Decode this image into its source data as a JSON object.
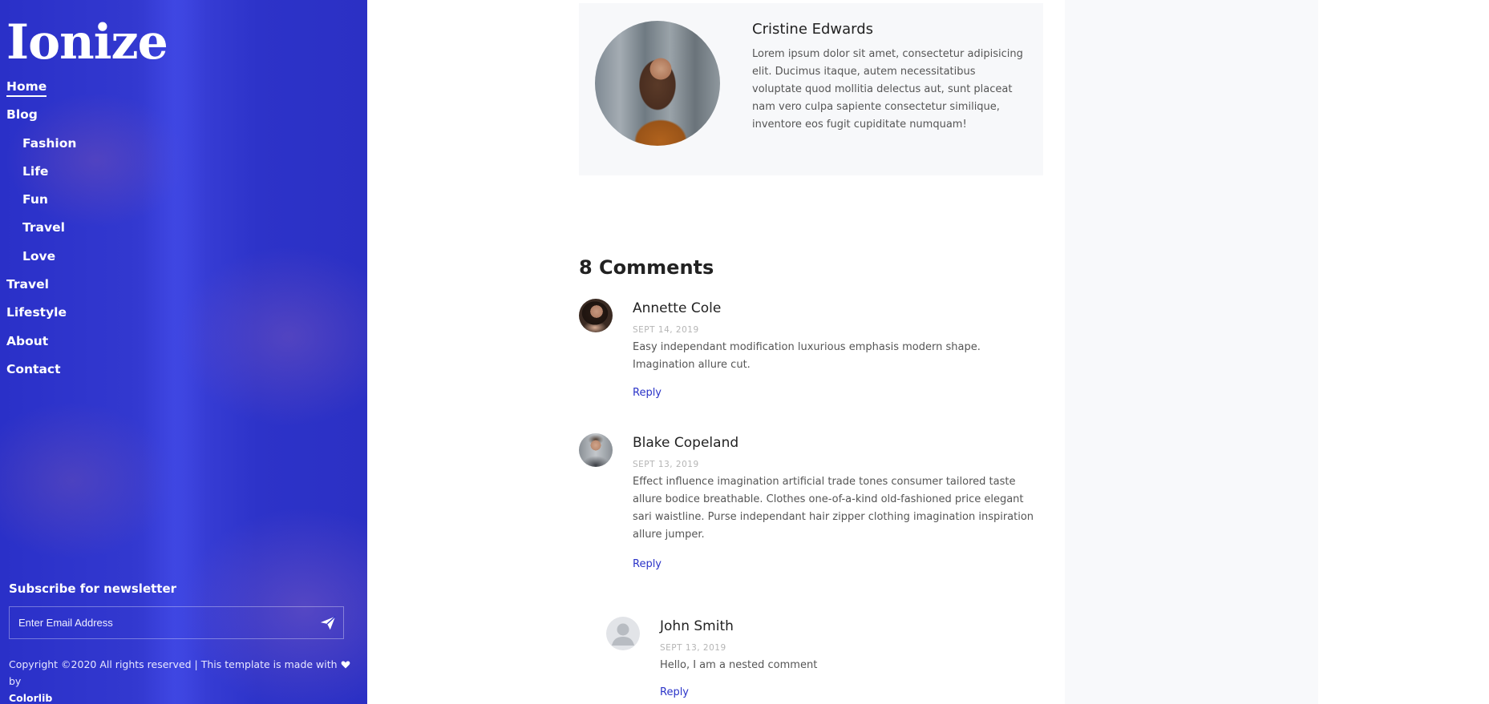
{
  "sidebar": {
    "logo": "Ionize",
    "nav": [
      {
        "label": "Home",
        "active": true,
        "sub": false
      },
      {
        "label": "Blog",
        "active": false,
        "sub": false
      },
      {
        "label": "Fashion",
        "active": false,
        "sub": true
      },
      {
        "label": "Life",
        "active": false,
        "sub": true
      },
      {
        "label": "Fun",
        "active": false,
        "sub": true
      },
      {
        "label": "Travel",
        "active": false,
        "sub": true
      },
      {
        "label": "Love",
        "active": false,
        "sub": true
      },
      {
        "label": "Travel",
        "active": false,
        "sub": false
      },
      {
        "label": "Lifestyle",
        "active": false,
        "sub": false
      },
      {
        "label": "About",
        "active": false,
        "sub": false
      },
      {
        "label": "Contact",
        "active": false,
        "sub": false
      }
    ],
    "newsletter": {
      "title": "Subscribe for newsletter",
      "placeholder": "Enter Email Address",
      "send_icon": "paper-plane-icon"
    },
    "copyright": {
      "text": "Copyright ©2020 All rights reserved | This template is made with",
      "heart_icon": "heart-icon",
      "by": "by",
      "brand": "Colorlib"
    },
    "accent_color": "#2b31c7"
  },
  "author": {
    "name": "Cristine Edwards",
    "bio": "Lorem ipsum dolor sit amet, consectetur adipisicing elit. Ducimus itaque, autem necessitatibus voluptate quod mollitia delectus aut, sunt placeat nam vero culpa sapiente consectetur similique, inventore eos fugit cupiditate numquam!"
  },
  "comments": {
    "heading": "8 Comments",
    "items": [
      {
        "name": "Annette Cole",
        "date": "SEPT 14, 2019",
        "text": "Easy independant modification luxurious emphasis modern shape. Imagination allure cut.",
        "reply": "Reply"
      },
      {
        "name": "Blake Copeland",
        "date": "SEPT 13, 2019",
        "text": "Effect influence imagination artificial trade tones consumer tailored taste allure bodice breathable. Clothes one-of-a-kind old-fashioned price elegant sari waistline. Purse independant hair zipper clothing imagination inspiration allure jumper.",
        "reply": "Reply"
      },
      {
        "name": "John Smith",
        "date": "SEPT 13, 2019",
        "text": "Hello, I am a nested comment",
        "reply": "Reply"
      }
    ],
    "link_color": "#2a33c8"
  }
}
